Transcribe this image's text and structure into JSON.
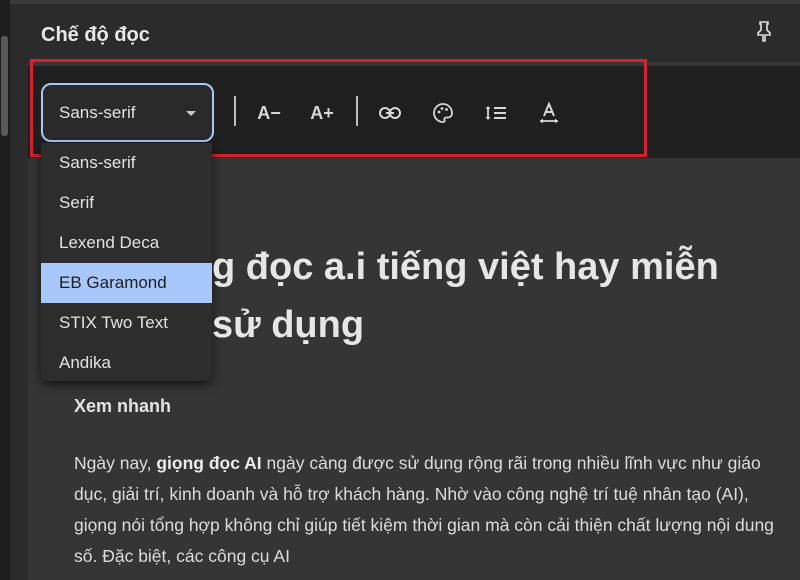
{
  "panel": {
    "title": "Chế độ đọc",
    "pin_icon": "pin-icon"
  },
  "toolbar": {
    "font_select_value": "Sans-serif",
    "decrease_font_label": "A−",
    "increase_font_label": "A+",
    "icons": [
      "link-icon",
      "palette-icon",
      "line-spacing-icon",
      "letter-spacing-icon"
    ]
  },
  "dropdown": {
    "options": [
      "Sans-serif",
      "Serif",
      "Lexend Deca",
      "EB Garamond",
      "STIX Two Text",
      "Andika"
    ],
    "selected": "EB Garamond"
  },
  "article": {
    "title_line1": "g đọc a.i tiếng việt hay miễn",
    "title_line2": "sử dụng",
    "subhead": "Xem nhanh",
    "para_start": "Ngày nay, ",
    "para_bold": "giọng đọc AI",
    "para_rest": " ngày càng được sử dụng rộng rãi trong nhiều lĩnh vực như giáo dục, giải trí, kinh doanh và hỗ trợ khách hàng. Nhờ vào công nghệ trí tuệ nhân tạo (AI), giọng nói tổng hợp không chỉ giúp tiết kiệm thời gian mà còn cải thiện chất lượng nội dung số. Đặc biệt, các công cụ AI"
  },
  "colors": {
    "accent": "#a8c7fa",
    "highlight_border": "#d4202f",
    "toolbar_bg": "#1f1f1f",
    "reader_bg": "#353535"
  }
}
